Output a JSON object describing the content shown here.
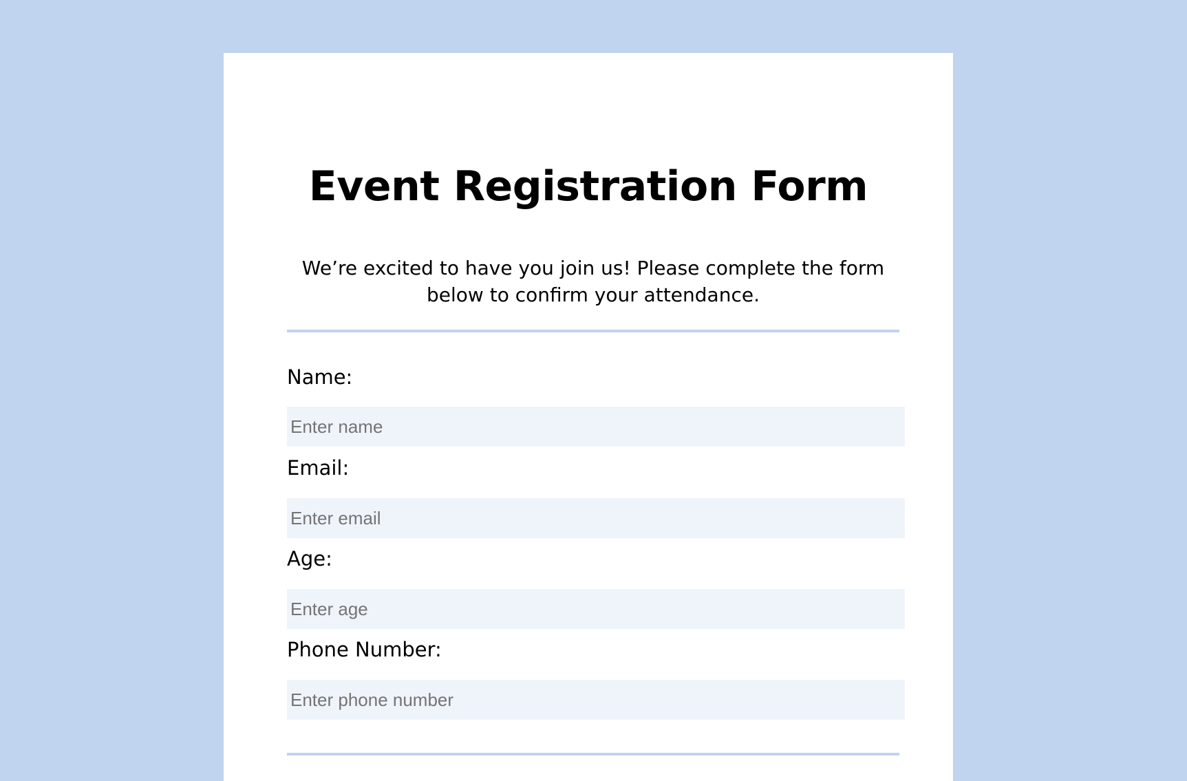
{
  "form": {
    "title": "Event Registration Form",
    "intro": "We’re excited to have you join us! Please complete the form below to confirm your attendance.",
    "fields": [
      {
        "label": "Name:",
        "placeholder": "Enter name",
        "value": ""
      },
      {
        "label": "Email:",
        "placeholder": "Enter email",
        "value": ""
      },
      {
        "label": "Age:",
        "placeholder": "Enter age",
        "value": ""
      },
      {
        "label": "Phone Number:",
        "placeholder": "Enter phone number",
        "value": ""
      }
    ]
  },
  "colors": {
    "page_background": "#c0d3ef",
    "card_background": "#ffffff",
    "input_background": "#eff4fb",
    "divider": "#c0d3ef"
  }
}
